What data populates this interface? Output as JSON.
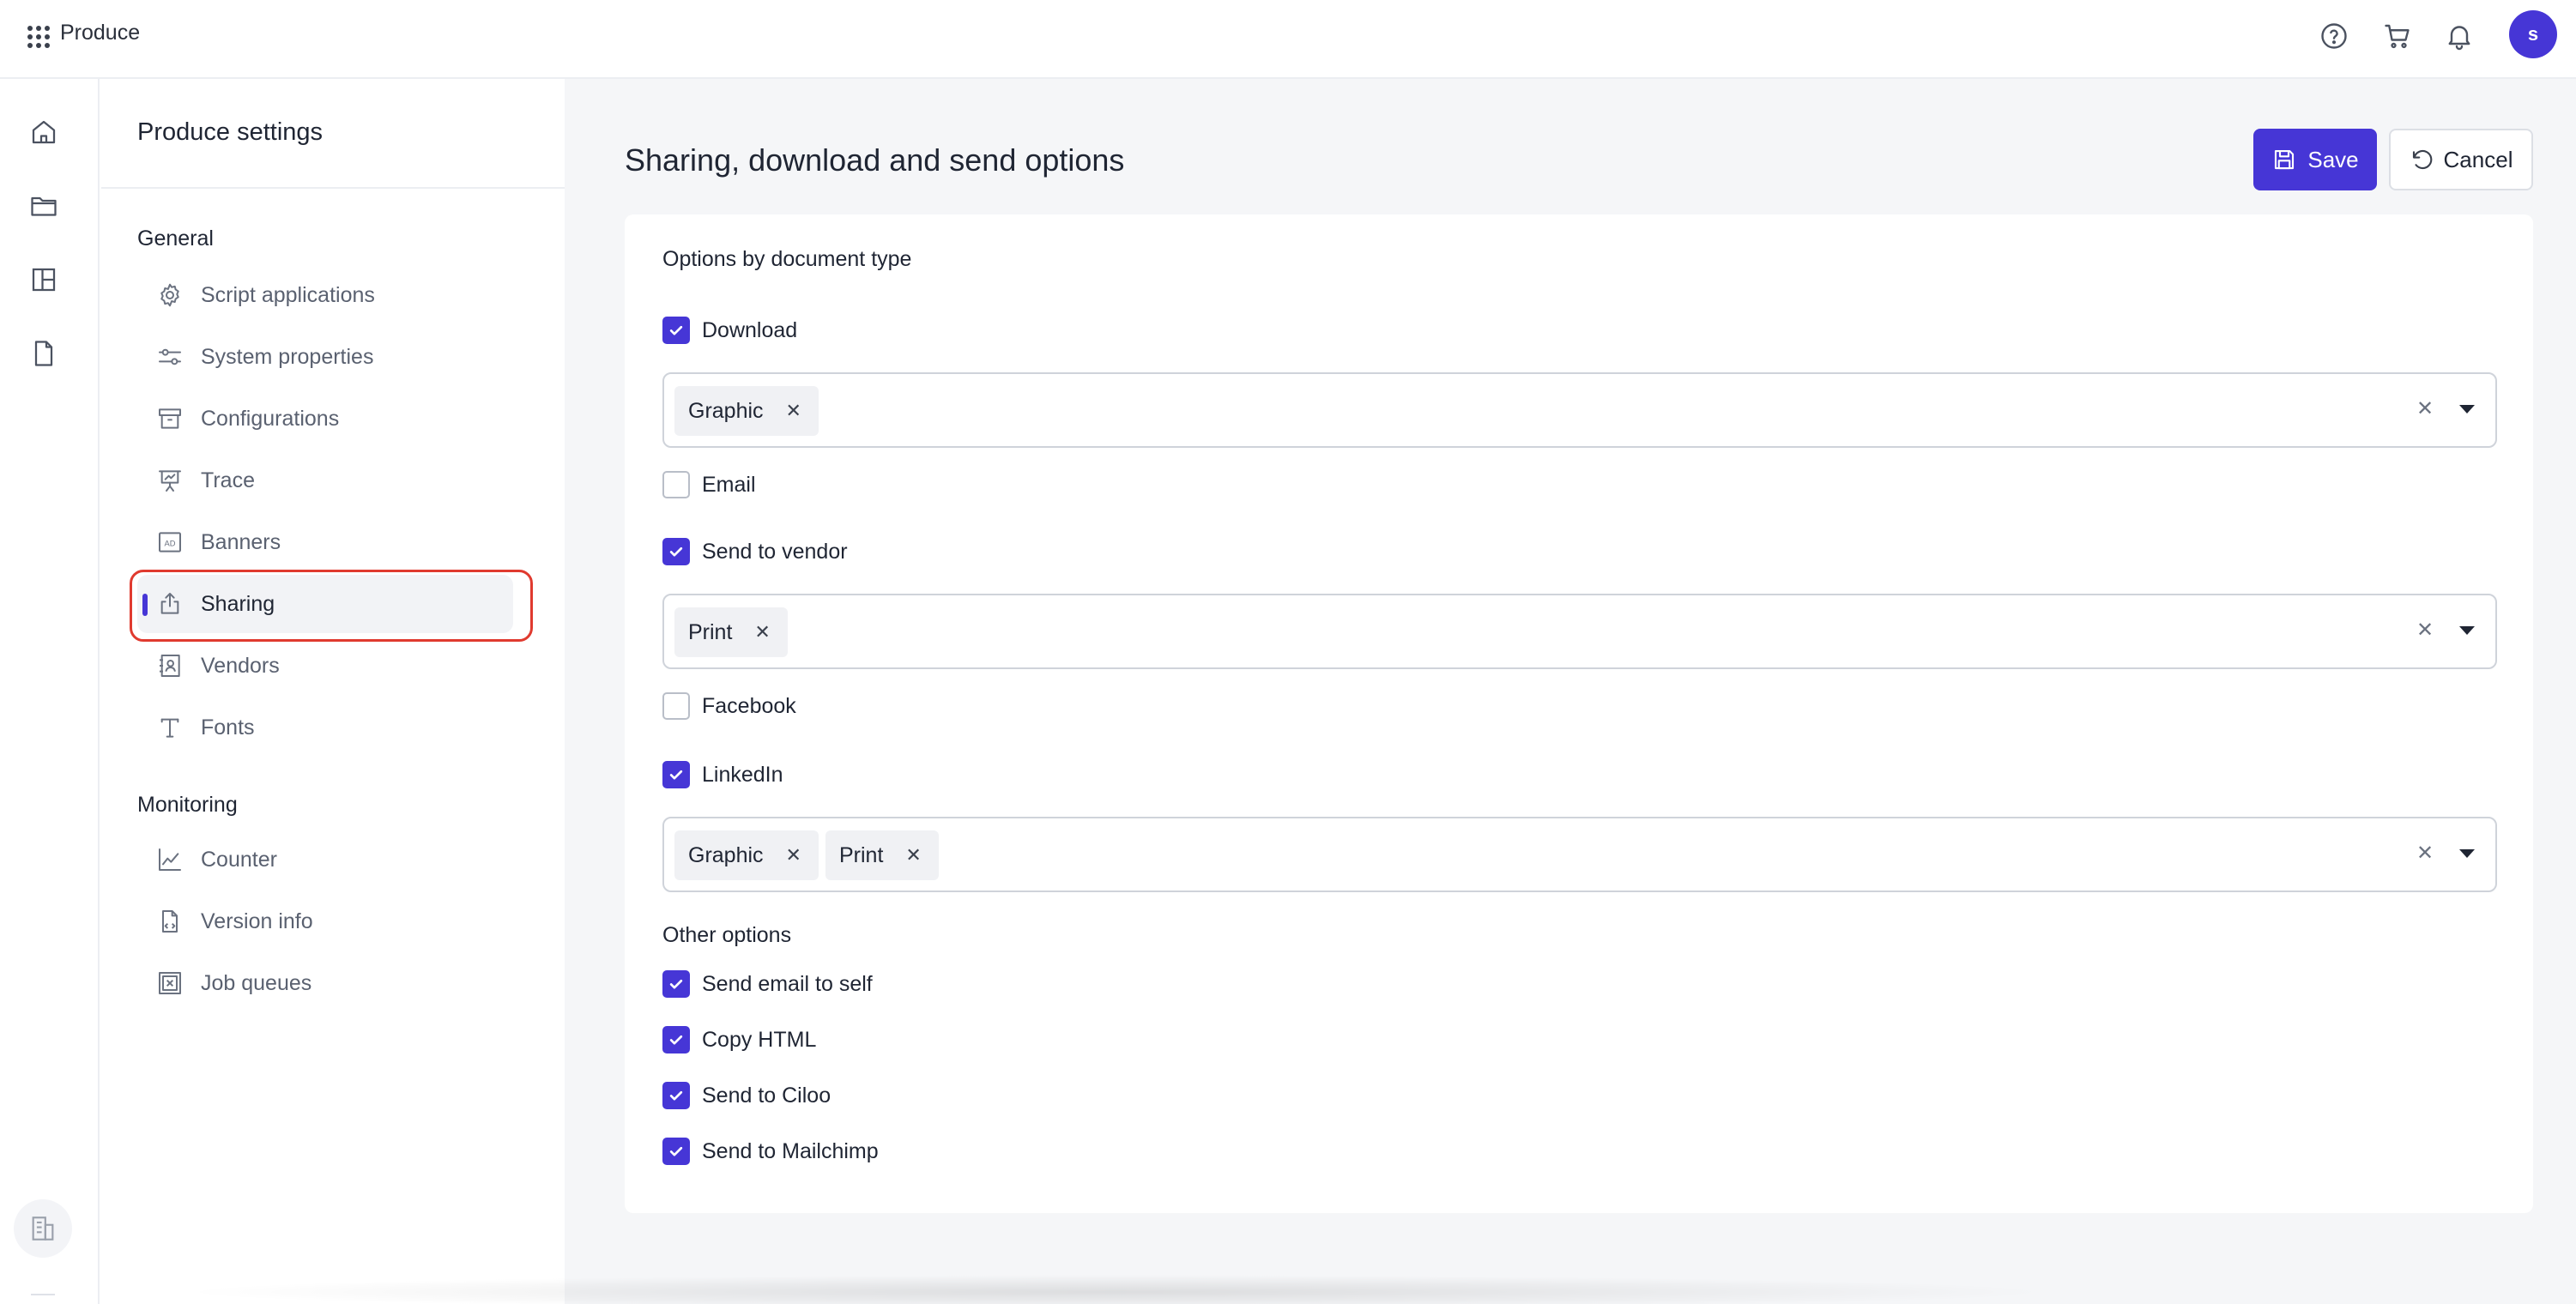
{
  "app": {
    "name": "Produce"
  },
  "user": {
    "initial": "s"
  },
  "theme": {
    "accent": "#4636d6",
    "highlight_ring": "#e03a2f"
  },
  "top_icons": [
    "help-icon",
    "cart-icon",
    "bell-icon"
  ],
  "rail_icons": [
    "home-icon",
    "folder-icon",
    "layout-icon",
    "document-icon",
    "building-icon",
    "gear-icon"
  ],
  "settings": {
    "title": "Produce settings",
    "groups": [
      {
        "title": "General",
        "items": [
          {
            "label": "Script applications",
            "icon": "gear-icon"
          },
          {
            "label": "System properties",
            "icon": "sliders-icon"
          },
          {
            "label": "Configurations",
            "icon": "archive-icon"
          },
          {
            "label": "Trace",
            "icon": "presentation-icon"
          },
          {
            "label": "Banners",
            "icon": "ad-icon"
          },
          {
            "label": "Sharing",
            "icon": "share-icon",
            "active": true
          },
          {
            "label": "Vendors",
            "icon": "contact-book-icon"
          },
          {
            "label": "Fonts",
            "icon": "font-icon"
          }
        ]
      },
      {
        "title": "Monitoring",
        "items": [
          {
            "label": "Counter",
            "icon": "line-chart-icon"
          },
          {
            "label": "Version info",
            "icon": "file-code-icon"
          },
          {
            "label": "Job queues",
            "icon": "queue-icon"
          }
        ]
      }
    ]
  },
  "main": {
    "title": "Sharing, download and send options",
    "save_label": "Save",
    "cancel_label": "Cancel",
    "options_by_doc_title": "Options by document type",
    "doc_options": [
      {
        "label": "Download",
        "checked": true,
        "tags": [
          "Graphic"
        ]
      },
      {
        "label": "Email",
        "checked": false
      },
      {
        "label": "Send to vendor",
        "checked": true,
        "tags": [
          "Print"
        ]
      },
      {
        "label": "Facebook",
        "checked": false
      },
      {
        "label": "LinkedIn",
        "checked": true,
        "tags": [
          "Graphic",
          "Print"
        ]
      }
    ],
    "other_options_title": "Other options",
    "other_options": [
      {
        "label": "Send email to self",
        "checked": true
      },
      {
        "label": "Copy HTML",
        "checked": true
      },
      {
        "label": "Send to Ciloo",
        "checked": true
      },
      {
        "label": "Send to Mailchimp",
        "checked": true
      }
    ]
  }
}
